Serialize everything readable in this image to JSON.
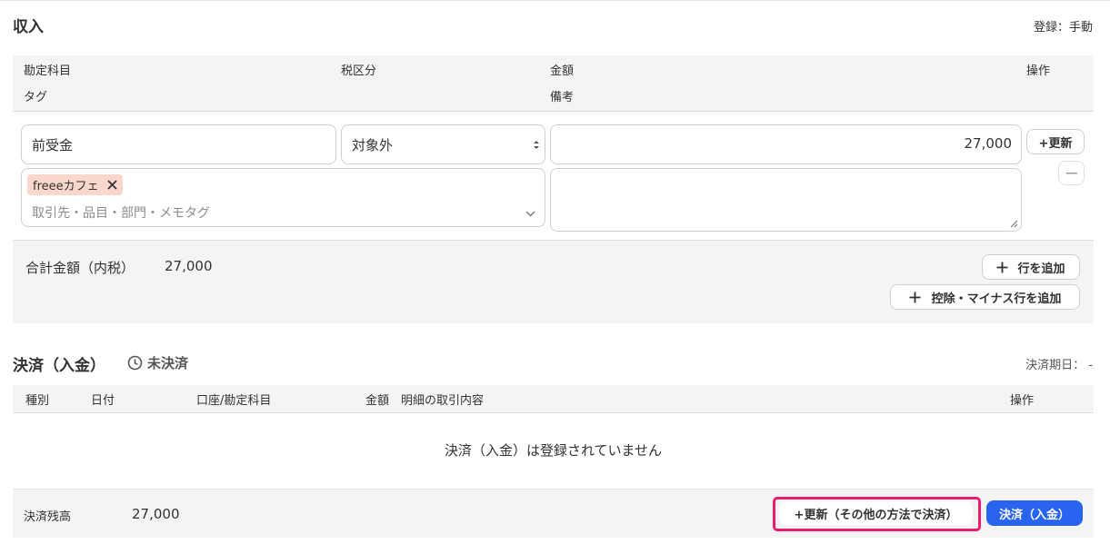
{
  "income": {
    "title": "収入",
    "registration": "登録：手動",
    "headers": {
      "account": "勘定科目",
      "tax": "税区分",
      "amount": "金額",
      "actions": "操作",
      "tag": "タグ",
      "memo": "備考"
    },
    "row": {
      "account_value": "前受金",
      "tax_value": "対象外",
      "amount_value": "27,000",
      "update_button": "+更新",
      "tag_chip": "freeeカフェ",
      "tag_placeholder": "取引先・品目・部門・メモタグ",
      "memo_value": ""
    },
    "total": {
      "label": "合計金額（内税）",
      "value": "27,000",
      "add_row_button": "行を追加",
      "add_deduction_button": "控除・マイナス行を追加"
    }
  },
  "settlement": {
    "title": "決済（入金）",
    "status": "未決済",
    "due_date": "決済期日： -",
    "headers": {
      "type": "種別",
      "date": "日付",
      "account": "口座/勘定科目",
      "amount": "金額",
      "detail": "明細の取引内容",
      "actions": "操作"
    },
    "empty_message": "決済（入金）は登録されていません",
    "balance_label": "決済残高",
    "balance_value": "27,000",
    "other_method_button": "+更新（その他の方法で決済）",
    "settle_button": "決済（入金）"
  },
  "colors": {
    "accent": "#2864f0",
    "highlight": "#ee1c6e",
    "tag_bg": "#f9d7cc",
    "band_bg": "#f5f4f4"
  }
}
